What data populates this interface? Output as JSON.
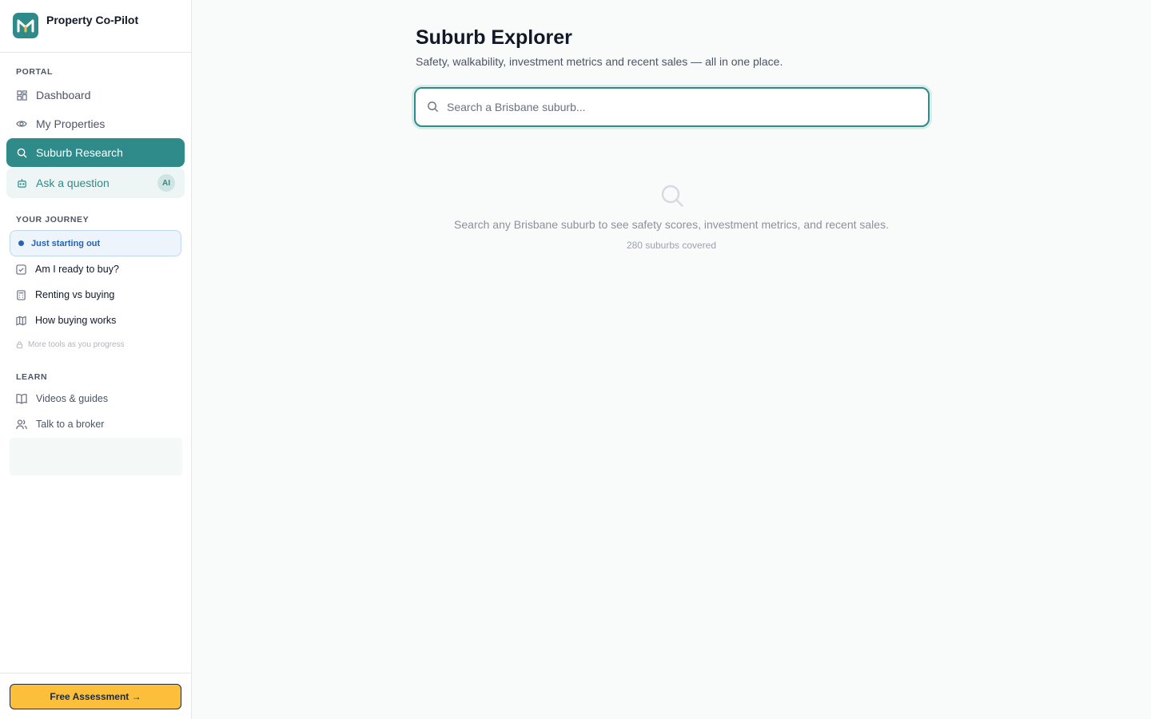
{
  "app": {
    "name": "Property Co-Pilot",
    "logo_color": "#2e8b8a"
  },
  "sidebar": {
    "portal_label": "PORTAL",
    "portal_items": [
      {
        "label": "Dashboard",
        "icon": "grid-icon"
      },
      {
        "label": "My Properties",
        "icon": "eye-icon"
      },
      {
        "label": "Suburb Research",
        "icon": "search-icon",
        "active": true
      },
      {
        "label": "Ask a question",
        "icon": "bot-icon",
        "badge": "AI"
      }
    ],
    "journey_label": "YOUR JOURNEY",
    "journey_stage": "Just starting out",
    "journey_items": [
      {
        "label": "Am I ready to buy?",
        "icon": "checkbox-icon"
      },
      {
        "label": "Renting vs buying",
        "icon": "calculator-icon"
      },
      {
        "label": "How buying works",
        "icon": "map-icon"
      }
    ],
    "locked_text": "More tools as you progress",
    "learn_label": "LEARN",
    "learn_items": [
      {
        "label": "Videos & guides",
        "icon": "book-icon"
      },
      {
        "label": "Talk to a broker",
        "icon": "users-icon"
      }
    ],
    "cta_label": "Free Assessment →"
  },
  "main": {
    "title": "Suburb Explorer",
    "subtitle": "Safety, walkability, investment metrics and recent sales — all in one place.",
    "search_placeholder": "Search a Brisbane suburb...",
    "search_value": "",
    "empty_text": "Search any Brisbane suburb to see safety scores, investment metrics, and recent sales.",
    "empty_count": "280 suburbs covered"
  },
  "colors": {
    "accent": "#2e8b8a",
    "cta": "#fbbf3c",
    "journey": "#2563b6"
  }
}
